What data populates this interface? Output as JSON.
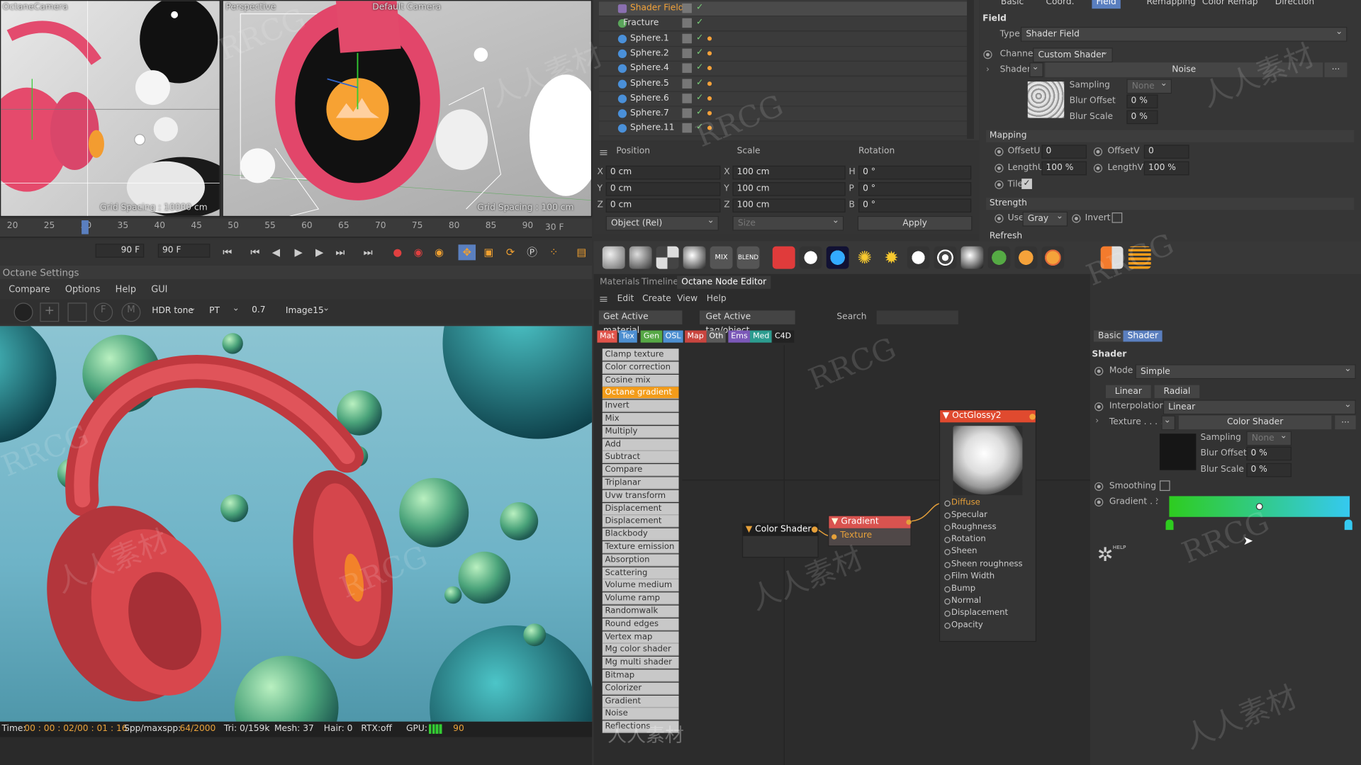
{
  "viewport_left": {
    "camera": "OctaneCamera",
    "grid": "Grid Spacing : 10000 cm"
  },
  "viewport_persp": {
    "title": "Perspective",
    "camera": "Default Camera",
    "grid": "Grid Spacing : 100 cm"
  },
  "timeline": {
    "ticks": [
      "20",
      "25",
      "30",
      "35",
      "40",
      "45",
      "50",
      "55",
      "60",
      "65",
      "70",
      "75",
      "80",
      "85",
      "90"
    ],
    "end_label": "30 F",
    "field_a": "90 F",
    "field_b": "90 F"
  },
  "octane_settings": {
    "title": "Octane Settings",
    "menu": [
      "Compare",
      "Options",
      "Help",
      "GUI"
    ],
    "tonemap": "HDR tone",
    "kernel": "PT",
    "value": "0.7",
    "image": "Image15"
  },
  "render_status": {
    "time_label": "Time:",
    "time": "00 : 00 : 02/00 : 01 : 16",
    "spp_label": "Spp/maxspp:",
    "spp": "64/2000",
    "tri": "Tri: 0/159k",
    "mesh": "Mesh: 37",
    "hair": "Hair: 0",
    "rtx": "RTX:off",
    "gpu_label": "GPU:",
    "gpu": "90"
  },
  "objects": {
    "items": [
      {
        "label": "Shader Field"
      },
      {
        "label": "Fracture"
      },
      {
        "label": "Sphere.1"
      },
      {
        "label": "Sphere.2"
      },
      {
        "label": "Sphere.4"
      },
      {
        "label": "Sphere.5"
      },
      {
        "label": "Sphere.6"
      },
      {
        "label": "Sphere.7"
      },
      {
        "label": "Sphere.11"
      }
    ]
  },
  "coords": {
    "position": "Position",
    "scale": "Scale",
    "rotation": "Rotation",
    "x": "0 cm",
    "y": "0 cm",
    "z": "0 cm",
    "sx": "100 cm",
    "sy": "100 cm",
    "sz": "100 cm",
    "h": "0 °",
    "p": "0 °",
    "b": "0 °",
    "mode": "Object (Rel)",
    "size": "Size",
    "apply": "Apply"
  },
  "attr": {
    "tabs": [
      "Basic",
      "Coord.",
      "Field",
      "Remapping",
      "Color Remap",
      "Direction"
    ],
    "section": "Field",
    "type_label": "Type",
    "type": "Shader Field",
    "channel_label": "Channel",
    "channel": "Custom Shader",
    "shader_label": "Shader",
    "shader": "Noise",
    "sampling_label": "Sampling",
    "sampling": "None",
    "blur_offset_label": "Blur Offset",
    "blur_offset": "0 %",
    "blur_scale_label": "Blur Scale",
    "blur_scale": "0 %",
    "mapping": "Mapping",
    "offsetu_label": "OffsetU",
    "offsetu": "0",
    "offsetv_label": "OffsetV",
    "offsetv": "0",
    "lengthu_label": "LengthU",
    "lengthu": "100 %",
    "lengthv_label": "LengthV",
    "lengthv": "100 %",
    "tile_label": "Tile",
    "strength": "Strength",
    "use_label": "Use",
    "use": "Gray",
    "invert_label": "Invert",
    "refresh": "Refresh"
  },
  "editor": {
    "tabs": [
      "Materials",
      "Timeline",
      "Octane Node Editor"
    ],
    "menu": [
      "Edit",
      "Create",
      "View",
      "Help"
    ],
    "btn_active_mat": "Get Active material",
    "btn_active_tag": "Get Active tag/object",
    "search_label": "Search",
    "categories": [
      {
        "label": "Mat",
        "color": "#e0534a"
      },
      {
        "label": "Tex",
        "color": "#4d8fd1"
      },
      {
        "label": "Gen",
        "color": "#56a845"
      },
      {
        "label": "OSL",
        "color": "#4d8fd1"
      },
      {
        "label": "Map",
        "color": "#c9453f"
      },
      {
        "label": "Oth",
        "color": "#5a5a5a"
      },
      {
        "label": "Ems",
        "color": "#7b58b8"
      },
      {
        "label": "Med",
        "color": "#2c9c8f"
      },
      {
        "label": "C4D",
        "color": "#222222"
      }
    ],
    "list": [
      "Clamp texture",
      "Color correction",
      "Cosine mix",
      "Octane gradient",
      "Invert",
      "Mix",
      "Multiply",
      "Add",
      "Subtract",
      "Compare",
      "Triplanar",
      "Uvw transform",
      "Displacement",
      "Displacement mixer",
      "Blackbody emission",
      "Texture emission",
      "Absorption medium",
      "Scattering medium",
      "Volume medium",
      "Volume ramp",
      "Randomwalk medium",
      "Round edges",
      "Vertex map",
      "Mg color shader",
      "Mg multi shader",
      "Bitmap",
      "Colorizer",
      "Gradient",
      "Noise",
      "Reflections"
    ],
    "nodes": {
      "color_shader": "Color Shader",
      "gradient": "Gradient",
      "gradient_in": "Texture",
      "material": "OctGlossy2",
      "pins": [
        "Diffuse",
        "Specular",
        "Roughness",
        "Rotation",
        "Sheen",
        "Sheen roughness",
        "Film Width",
        "Bump",
        "Normal",
        "Displacement",
        "Opacity"
      ]
    }
  },
  "node_props": {
    "tabs": [
      "Basic",
      "Shader"
    ],
    "section": "Shader",
    "mode_label": "Mode",
    "mode": "Simple",
    "linear": "Linear",
    "radial": "Radial",
    "interp_label": "Interpolation",
    "interp": "Linear",
    "texture_label": "Texture . . . .",
    "texture": "Color Shader",
    "sampling_label": "Sampling",
    "sampling": "None",
    "blur_offset_label": "Blur Offset",
    "blur_offset": "0 %",
    "blur_scale_label": "Blur Scale",
    "blur_scale": "0 %",
    "smoothing_label": "Smoothing",
    "gradient_label": "Gradient . .",
    "help": "HELP",
    "grad_start": "#2ecc1f",
    "grad_end": "#35c9f0"
  },
  "watermarks": [
    "RRCG",
    "人人素材"
  ]
}
